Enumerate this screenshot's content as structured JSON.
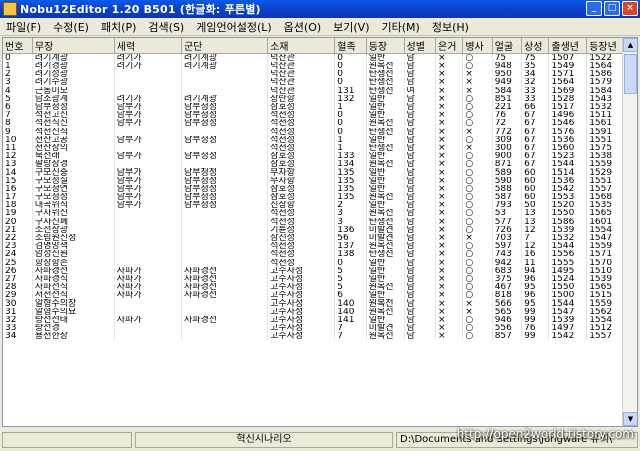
{
  "window": {
    "title": "Nobu12Editor 1.20 B501 (한글화: 푸른별)"
  },
  "menu": [
    "파일(F)",
    "수정(E)",
    "패치(P)",
    "검색(S)",
    "게임언어설정(L)",
    "옵션(O)",
    "보기(V)",
    "기타(M)",
    "정보(H)"
  ],
  "table": {
    "columns": [
      "번호",
      "무장",
      "세력",
      "군단",
      "소재",
      "혈족",
      "등장",
      "성별",
      "은거",
      "병사",
      "얼굴",
      "상성",
      "출생년",
      "등장년"
    ],
    "rows": [
      [
        "0",
        "려기계광",
        "려기가",
        "려기계광",
        "덕산관",
        "0",
        "일반",
        "남",
        "×",
        "○",
        "75",
        "75",
        "1507",
        "1522"
      ],
      [
        "1",
        "려기경광",
        "려기가",
        "려기계광",
        "덕산관",
        "0",
        "원복전",
        "남",
        "×",
        "○",
        "948",
        "35",
        "1549",
        "1564"
      ],
      [
        "2",
        "려기성광",
        "",
        "",
        "덕산관",
        "0",
        "탄생전",
        "남",
        "×",
        "×",
        "950",
        "34",
        "1571",
        "1586"
      ],
      [
        "3",
        "려기수광",
        "",
        "",
        "덕산관",
        "0",
        "탄생전",
        "남",
        "×",
        "×",
        "949",
        "32",
        "1564",
        "1579"
      ],
      [
        "4",
        "근동미모",
        "",
        "",
        "덕산관",
        "131",
        "탄생전",
        "여",
        "×",
        "×",
        "584",
        "33",
        "1569",
        "1584"
      ],
      [
        "5",
        "남조광계",
        "려기가",
        "려기계광",
        "상란항",
        "132",
        "일반",
        "남",
        "×",
        "○",
        "851",
        "33",
        "1528",
        "1543"
      ],
      [
        "6",
        "남부청정",
        "남부가",
        "남부청정",
        "삼호성",
        "1",
        "일반",
        "남",
        "×",
        "○",
        "221",
        "66",
        "1517",
        "1532"
      ],
      [
        "7",
        "석천고신",
        "남부가",
        "남부청정",
        "석천성",
        "0",
        "일반",
        "남",
        "×",
        "○",
        "76",
        "67",
        "1496",
        "1511"
      ],
      [
        "8",
        "석천직신",
        "남부가",
        "남부청정",
        "석천성",
        "0",
        "원복전",
        "남",
        "×",
        "○",
        "72",
        "67",
        "1546",
        "1561"
      ],
      [
        "9",
        "석천신직",
        "",
        "",
        "석천성",
        "0",
        "탄생전",
        "남",
        "×",
        "×",
        "772",
        "67",
        "1576",
        "1591"
      ],
      [
        "10",
        "천산고공",
        "남부가",
        "남부청정",
        "석천성",
        "1",
        "일반",
        "남",
        "×",
        "○",
        "309",
        "67",
        "1536",
        "1551"
      ],
      [
        "11",
        "천산장의",
        "",
        "",
        "석천성",
        "1",
        "탄생전",
        "남",
        "×",
        "×",
        "300",
        "67",
        "1560",
        "1575"
      ],
      [
        "12",
        "북전래",
        "남부가",
        "남부청정",
        "삼호성",
        "133",
        "일반",
        "남",
        "×",
        "○",
        "900",
        "67",
        "1523",
        "1538"
      ],
      [
        "13",
        "팔랑장경",
        "",
        "",
        "삼호성",
        "134",
        "원복전",
        "남",
        "×",
        "○",
        "871",
        "67",
        "1544",
        "1559"
      ],
      [
        "14",
        "구모신중",
        "남부가",
        "남부청정",
        "무자항",
        "135",
        "일반",
        "남",
        "×",
        "○",
        "589",
        "60",
        "1514",
        "1529"
      ],
      [
        "15",
        "구모정실",
        "남부가",
        "남부청정",
        "무자항",
        "135",
        "일반",
        "남",
        "×",
        "○",
        "590",
        "60",
        "1536",
        "1551"
      ],
      [
        "16",
        "구모청연",
        "남부가",
        "남부청정",
        "삼호성",
        "135",
        "일반",
        "남",
        "×",
        "○",
        "588",
        "60",
        "1542",
        "1557"
      ],
      [
        "17",
        "구모청정",
        "남부가",
        "남부청정",
        "삼호성",
        "135",
        "원복전",
        "남",
        "×",
        "○",
        "587",
        "60",
        "1553",
        "1568"
      ],
      [
        "18",
        "대곡위직",
        "남부가",
        "남부청정",
        "진상항",
        "2",
        "일반",
        "남",
        "×",
        "○",
        "793",
        "50",
        "1520",
        "1535"
      ],
      [
        "19",
        "구자위신",
        "",
        "",
        "석천성",
        "3",
        "원복전",
        "남",
        "×",
        "○",
        "53",
        "13",
        "1550",
        "1565"
      ],
      [
        "20",
        "구자신폐",
        "",
        "",
        "석천성",
        "3",
        "탄생전",
        "남",
        "×",
        "○",
        "577",
        "13",
        "1586",
        "1601"
      ],
      [
        "21",
        "소전상광",
        "",
        "",
        "기륜성",
        "136",
        "미발견",
        "남",
        "×",
        "○",
        "726",
        "12",
        "1539",
        "1554"
      ],
      [
        "22",
        "소림원신정",
        "",
        "",
        "삼진성",
        "56",
        "미발견",
        "남",
        "×",
        "×",
        "703",
        "7",
        "1532",
        "1547"
      ],
      [
        "23",
        "검명망책",
        "",
        "",
        "석천성",
        "137",
        "원복전",
        "남",
        "×",
        "○",
        "597",
        "12",
        "1544",
        "1559"
      ],
      [
        "24",
        "암성신원",
        "",
        "",
        "석천성",
        "138",
        "탄생전",
        "남",
        "×",
        "○",
        "743",
        "16",
        "1556",
        "1571"
      ],
      [
        "25",
        "항장항손",
        "",
        "",
        "석천성",
        "0",
        "일반",
        "남",
        "×",
        "○",
        "942",
        "11",
        "1555",
        "1570"
      ],
      [
        "26",
        "사파경전",
        "사파가",
        "사파경전",
        "고수사성",
        "5",
        "일반",
        "남",
        "×",
        "○",
        "683",
        "94",
        "1495",
        "1510"
      ],
      [
        "27",
        "사파경직",
        "사파가",
        "사파경전",
        "고수사성",
        "5",
        "일반",
        "남",
        "×",
        "○",
        "375",
        "96",
        "1524",
        "1539"
      ],
      [
        "28",
        "사파전직",
        "사파가",
        "사파경전",
        "고수사성",
        "5",
        "원복전",
        "남",
        "×",
        "○",
        "467",
        "95",
        "1550",
        "1565"
      ],
      [
        "29",
        "저천전직",
        "사파가",
        "사파경전",
        "고수사성",
        "6",
        "일반",
        "남",
        "×",
        "○",
        "818",
        "96",
        "1500",
        "1515"
      ],
      [
        "30",
        "알형수의장",
        "",
        "",
        "고수사성",
        "140",
        "원복전",
        "남",
        "×",
        "×",
        "566",
        "95",
        "1544",
        "1559"
      ],
      [
        "31",
        "알형수의묘",
        "",
        "",
        "고수사성",
        "140",
        "원복전",
        "남",
        "×",
        "×",
        "565",
        "99",
        "1547",
        "1562"
      ],
      [
        "32",
        "량전전태",
        "사파가",
        "사파경전",
        "고수사성",
        "141",
        "일반",
        "남",
        "×",
        "○",
        "946",
        "99",
        "1539",
        "1554"
      ],
      [
        "33",
        "량전경",
        "",
        "",
        "고수사성",
        "7",
        "미발견",
        "남",
        "×",
        "○",
        "556",
        "76",
        "1497",
        "1512"
      ],
      [
        "34",
        "용천한장",
        "",
        "",
        "고수사성",
        "7",
        "원복전",
        "남",
        "×",
        "○",
        "857",
        "99",
        "1542",
        "1557"
      ]
    ]
  },
  "status": {
    "left": "",
    "center": "혁신시나리오",
    "path": "D:\\Documents and Settings\\Jungware 유리\\"
  },
  "watermark": "http://open2world.tistory.com"
}
